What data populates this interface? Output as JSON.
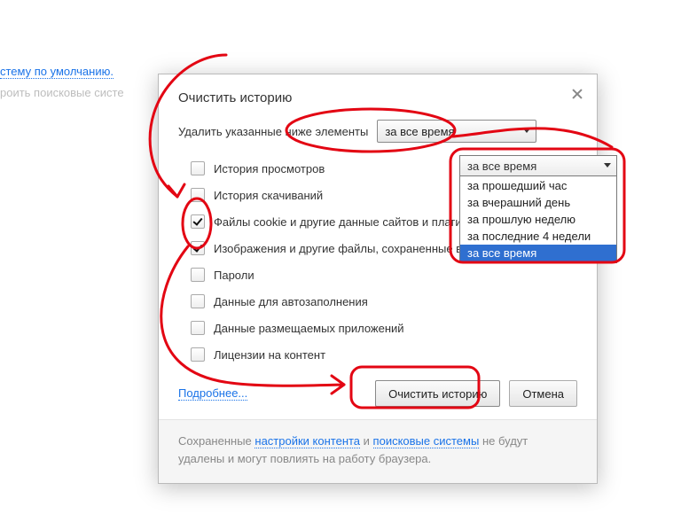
{
  "background": {
    "link1": "стему по умолчанию.",
    "text2_prefix": "роить поисковые систе",
    "link2": ""
  },
  "dialog": {
    "title": "Очистить историю",
    "delete_label": "Удалить указанные ниже элементы",
    "range_selected": "за все время",
    "options": [
      {
        "label": "История просмотров",
        "checked": false
      },
      {
        "label": "История скачиваний",
        "checked": false
      },
      {
        "label": "Файлы cookie и другие данные сайтов и плагинов",
        "checked": true
      },
      {
        "label": "Изображения и другие файлы, сохраненные в кеше",
        "checked": true
      },
      {
        "label": "Пароли",
        "checked": false
      },
      {
        "label": "Данные для автозаполнения",
        "checked": false
      },
      {
        "label": "Данные размещаемых приложений",
        "checked": false
      },
      {
        "label": "Лицензии на контент",
        "checked": false
      }
    ],
    "more": "Подробнее...",
    "clear_btn": "Очистить историю",
    "cancel_btn": "Отмена",
    "footer_prefix": "Сохраненные ",
    "footer_link1": "настройки контента",
    "footer_mid": " и ",
    "footer_link2": "поисковые системы",
    "footer_suffix": " не будут удалены и могут повлиять на работу браузера."
  },
  "dropdown_list": {
    "head": "за все время",
    "items": [
      {
        "label": "за прошедший час",
        "selected": false
      },
      {
        "label": "за вчерашний день",
        "selected": false
      },
      {
        "label": "за прошлую неделю",
        "selected": false
      },
      {
        "label": "за последние 4 недели",
        "selected": false
      },
      {
        "label": "за все время",
        "selected": true
      }
    ]
  },
  "annotation": {
    "color": "#e30613"
  }
}
